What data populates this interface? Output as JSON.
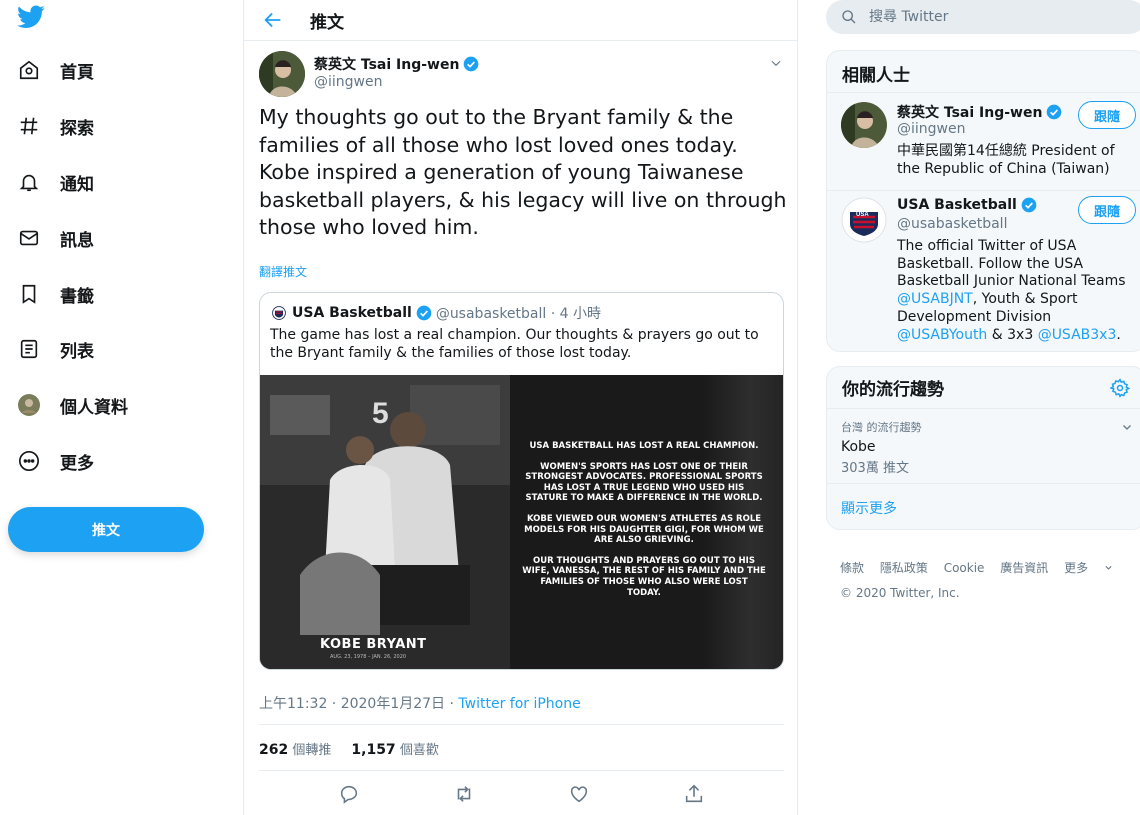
{
  "nav": {
    "items": [
      {
        "label": "首頁",
        "icon": "home-icon"
      },
      {
        "label": "探索",
        "icon": "hashtag-icon"
      },
      {
        "label": "通知",
        "icon": "bell-icon"
      },
      {
        "label": "訊息",
        "icon": "mail-icon"
      },
      {
        "label": "書籤",
        "icon": "bookmark-icon"
      },
      {
        "label": "列表",
        "icon": "list-icon"
      },
      {
        "label": "個人資料",
        "icon": "avatar-icon"
      },
      {
        "label": "更多",
        "icon": "more-icon"
      }
    ],
    "tweet_button": "推文"
  },
  "header": {
    "title": "推文"
  },
  "tweet": {
    "author_name": "蔡英文 Tsai Ing-wen",
    "author_handle": "@iingwen",
    "text": "My thoughts go out to the Bryant family & the families of all those who lost loved ones today. Kobe inspired a generation of young Taiwanese basketball players, & his legacy will live on through those who loved him.",
    "translate": "翻譯推文",
    "quote": {
      "name": "USA Basketball",
      "handle": "@usabasketball · 4 小時",
      "text": "The game has lost a real champion. Our thoughts & prayers go out to the Bryant family & the families of those lost today.",
      "image_lines": [
        "USA BASKETBALL HAS LOST A REAL CHAMPION.",
        "WOMEN'S SPORTS HAS LOST ONE OF THEIR STRONGEST ADVOCATES. PROFESSIONAL SPORTS HAS LOST A TRUE LEGEND WHO USED HIS STATURE TO MAKE A DIFFERENCE IN THE WORLD.",
        "KOBE VIEWED OUR WOMEN'S ATHLETES AS ROLE MODELS FOR HIS DAUGHTER GIGI, FOR WHOM WE ARE ALSO GRIEVING.",
        "OUR THOUGHTS AND PRAYERS GO OUT TO HIS WIFE, VANESSA, THE REST OF HIS FAMILY AND THE FAMILIES OF THOSE WHO ALSO WERE LOST TODAY."
      ],
      "image_name": "KOBE BRYANT",
      "image_dates": "AUG. 23, 1978 – JAN. 26, 2020"
    },
    "timestamp": "上午11:32 · 2020年1月27日 · ",
    "source": "Twitter for iPhone",
    "retweets_count": "262",
    "retweets_label": "個轉推",
    "likes_count": "1,157",
    "likes_label": "個喜歡"
  },
  "search": {
    "placeholder": "搜尋 Twitter"
  },
  "related": {
    "title": "相關人士",
    "people": [
      {
        "name": "蔡英文 Tsai Ing-wen",
        "handle": "@iingwen",
        "bio": "中華民國第14任總統 President of the Republic of China (Taiwan)",
        "follow": "跟隨"
      },
      {
        "name": "USA Basketball",
        "handle": "@usabasketball",
        "bio_part1": "The official Twitter of USA Basketball. Follow the USA Basketball Junior National Teams ",
        "bio_link1": "@USABJNT",
        "bio_part2": ", Youth & Sport Development Division ",
        "bio_link2": "@USABYouth",
        "bio_part3": " & 3x3 ",
        "bio_link3": "@USAB3x3",
        "bio_part4": ".",
        "follow": "跟隨"
      }
    ]
  },
  "trends": {
    "title": "你的流行趨勢",
    "items": [
      {
        "context": "台灣 的流行趨勢",
        "name": "Kobe",
        "count": "303萬 推文"
      }
    ],
    "show_more": "顯示更多"
  },
  "footer": {
    "links": [
      "條款",
      "隱私政策",
      "Cookie",
      "廣告資訊",
      "更多"
    ],
    "copyright": "© 2020 Twitter, Inc."
  },
  "colors": {
    "accent": "#1da1f2",
    "secondary_text": "#657786",
    "border": "#e6ecf0"
  }
}
